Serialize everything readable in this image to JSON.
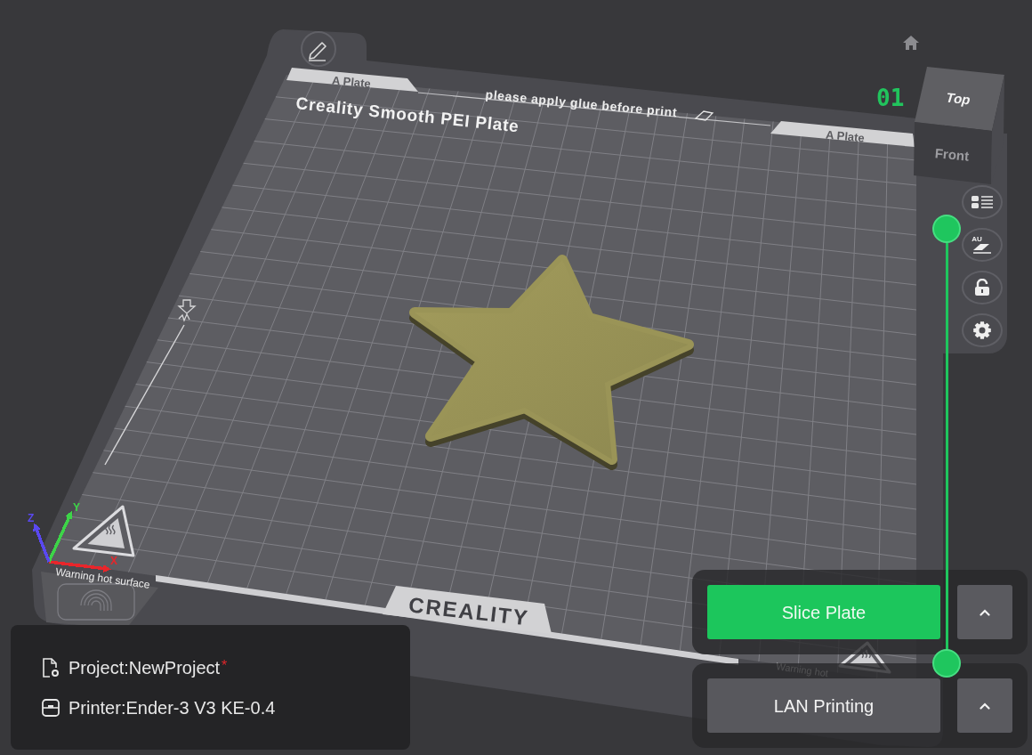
{
  "viewport": {
    "plate": {
      "tabs": [
        "A Plate",
        "A Plate"
      ],
      "notice": "please apply glue before print",
      "title": "Creality Smooth PEI Plate",
      "logo": "CREALITY",
      "warnings": [
        "Warning hot surface",
        "Warning hot"
      ],
      "number": "01"
    },
    "axes": [
      {
        "label": "X",
        "color": "#e8262b"
      },
      {
        "label": "Y",
        "color": "#3dd448"
      },
      {
        "label": "Z",
        "color": "#5a48f0"
      }
    ],
    "view_cube": {
      "top": "Top",
      "front": "Front"
    }
  },
  "toolbar": {
    "auto_label": "AU"
  },
  "layer_slider": {
    "upper": {
      "level": 1
    },
    "lower": {
      "level": 0
    }
  },
  "actions": [
    {
      "label": "Slice Plate",
      "primary": true
    },
    {
      "label": "LAN Printing",
      "primary": false
    }
  ],
  "info": {
    "project": "Project:NewProject",
    "unsaved_mark": "*",
    "printer": "Printer:Ender-3 V3 KE-0.4"
  }
}
